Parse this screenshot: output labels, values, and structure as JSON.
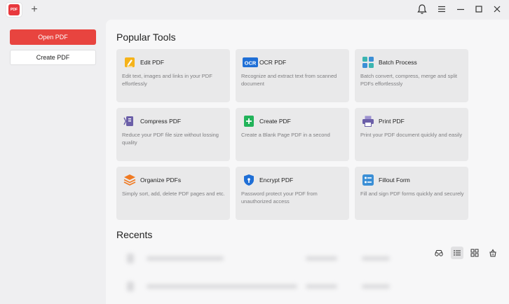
{
  "titlebar": {
    "logo_text": "PDF",
    "new_tab_label": "+"
  },
  "sidebar": {
    "open_label": "Open PDF",
    "create_label": "Create PDF"
  },
  "popular": {
    "title": "Popular Tools",
    "tools": [
      {
        "title": "Edit PDF",
        "desc": "Edit text, images and links in your PDF effortlessly",
        "icon": "edit-icon"
      },
      {
        "title": "OCR PDF",
        "desc": "Recognize and extract text from scanned document",
        "icon": "ocr-icon"
      },
      {
        "title": "Batch Process",
        "desc": "Batch convert, compress, merge and split PDFs effortlesssly",
        "icon": "batch-icon"
      },
      {
        "title": "Compress PDF",
        "desc": "Reduce your PDF file size without lossing quality",
        "icon": "compress-icon"
      },
      {
        "title": "Create PDF",
        "desc": "Create a Blank Page PDF in a second",
        "icon": "create-icon"
      },
      {
        "title": "Print PDF",
        "desc": "Print your PDF document quickly and easily",
        "icon": "print-icon"
      },
      {
        "title": "Organize PDFs",
        "desc": "Simply sort, add, delete PDF pages and etc.",
        "icon": "organize-icon"
      },
      {
        "title": "Encrypt PDF",
        "desc": "Password protect your PDF from unauthorized access",
        "icon": "encrypt-icon"
      },
      {
        "title": "Fillout Form",
        "desc": "Fill and sign PDF forms quickly and securely",
        "icon": "form-icon"
      }
    ]
  },
  "recents": {
    "title": "Recents"
  },
  "colors": {
    "accent": "#e8443f",
    "ocr_blue": "#1f6fd6",
    "create_green": "#22b35a",
    "organize_orange": "#f07a22",
    "purple": "#6b5fa8",
    "teal": "#3bb5b0"
  }
}
